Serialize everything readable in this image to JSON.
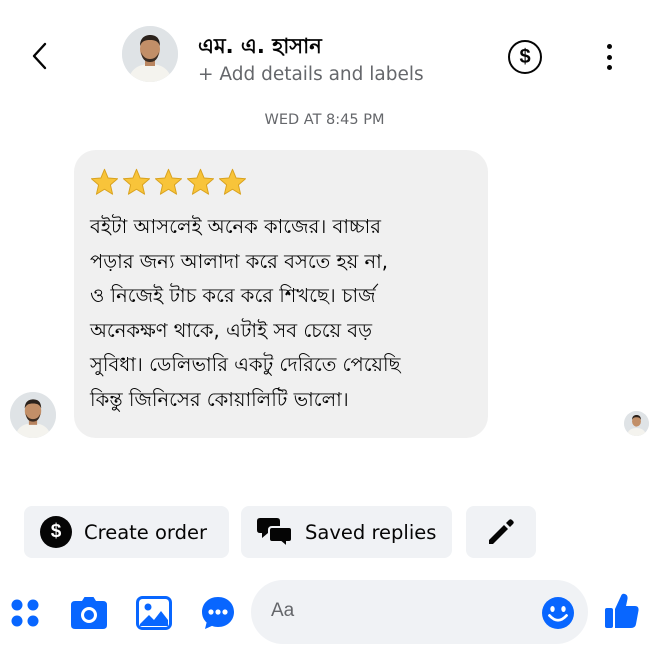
{
  "header": {
    "contact_name": "এম. এ. হাসান",
    "add_details_label": "+ Add details and labels",
    "payment_symbol": "$"
  },
  "conversation": {
    "timestamp": "WED AT 8:45 PM",
    "message": {
      "rating_stars": 5,
      "lines": [
        "বইটা আসলেই অনেক কাজের। বাচ্চার",
        "পড়ার জন্য আলাদা করে বসতে হয় না,",
        "ও নিজেই টাচ করে করে শিখছে। চার্জ",
        "অনেকক্ষণ থাকে, এটাই সব চেয়ে বড়",
        "সুবিধা। ডেলিভারি একটু দেরিতে পেয়েছি",
        "কিন্তু জিনিসের কোয়ালিটি ভালো।"
      ]
    }
  },
  "quick_actions": {
    "create_order_label": "Create order",
    "create_order_symbol": "$",
    "saved_replies_label": "Saved replies"
  },
  "composer": {
    "placeholder": "Aa"
  },
  "colors": {
    "accent": "#0866ff",
    "bubble": "#f0f0f0",
    "chip": "#f0f2f5",
    "secondary_text": "#65676b",
    "star": "#f8c43a"
  },
  "icons": [
    "back-chevron-icon",
    "dollar-icon",
    "more-vertical-icon",
    "star-icon",
    "chat-bubbles-icon",
    "pencil-icon",
    "apps-grid-icon",
    "camera-icon",
    "image-icon",
    "voice-bubble-icon",
    "emoji-icon",
    "thumbs-up-icon"
  ]
}
